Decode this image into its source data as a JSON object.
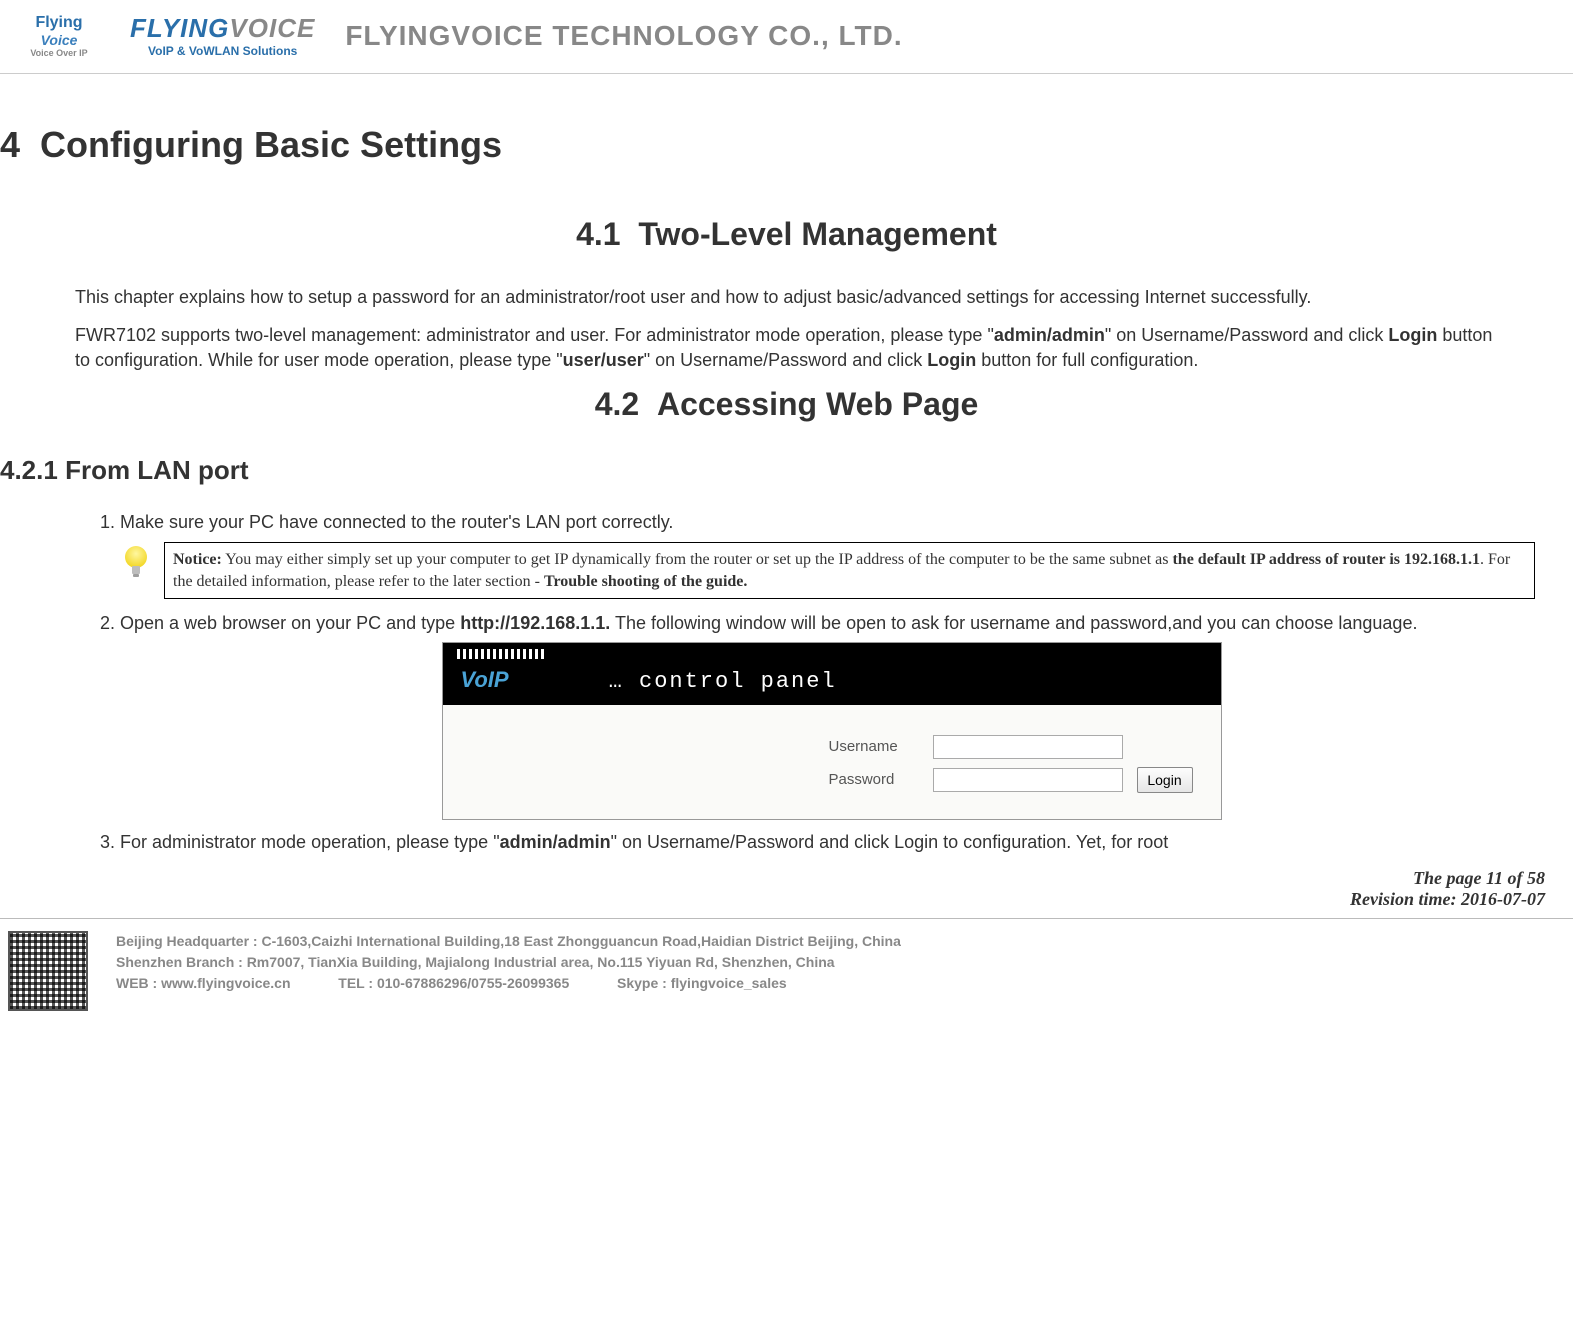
{
  "header": {
    "logo_left": {
      "line1": "Flying",
      "line2": "Voice",
      "line3": "Voice Over IP"
    },
    "logo_mid": {
      "main_a": "FLYING",
      "main_b": "VOICE",
      "sub": "VoIP & VoWLAN Solutions"
    },
    "company": "FLYINGVOICE TECHNOLOGY CO., LTD."
  },
  "chapter": {
    "num": "4",
    "title": "Configuring Basic Settings"
  },
  "s41": {
    "num": "4.1",
    "title": "Two-Level Management",
    "p1": "This chapter explains how to setup a password for an administrator/root user and how to adjust basic/advanced settings for accessing Internet successfully.",
    "p2a": "FWR7102 supports two-level management: administrator and user. For administrator mode operation, please type \"",
    "p2_admin": "admin/admin",
    "p2b": "\" on Username/Password and click ",
    "p2_login1": "Login",
    "p2c": " button to configuration. While for user mode operation, please type \"",
    "p2_user": "user/user",
    "p2d": "\" on Username/Password and click ",
    "p2_login2": "Login",
    "p2e": " button for full configuration."
  },
  "s42": {
    "num": "4.2",
    "title": "Accessing Web Page"
  },
  "s421": {
    "num": "4.2.1",
    "title": "From LAN port"
  },
  "steps": {
    "s1": "Make sure your PC have connected to the router's LAN port correctly.",
    "notice_label": "Notice:",
    "notice_a": " You may either simply set up your computer to get IP dynamically from the router or set up the IP address of the computer to be the same subnet as ",
    "notice_b": "the default IP address of router is 192.168.1.1",
    "notice_c": ". For the detailed information, please refer to the later section - ",
    "notice_d": "Trouble shooting of the guide.",
    "s2a": "Open a web browser on your PC and type ",
    "s2url": "http://192.168.1.1.",
    "s2b": " The following window will be open to ask for username and password,and you can choose language.",
    "s3a": "For administrator mode operation, please type \"",
    "s3admin": "admin/admin",
    "s3b": "\" on Username/Password and click Login to configuration. Yet, for root"
  },
  "login_panel": {
    "voip": "VoIP",
    "dots": "… control panel",
    "username_label": "Username",
    "password_label": "Password",
    "login_btn": "Login",
    "username_value": "",
    "password_value": ""
  },
  "meta": {
    "page": "The page 11 of 58",
    "rev": "Revision time: 2016-07-07"
  },
  "footer": {
    "l1a": "Beijing Headquarter ",
    "l1b": ": C-1603,Caizhi International Building,18 East Zhongguancun Road,Haidian District Beijing, China",
    "l2a": "Shenzhen Branch : ",
    "l2b": "Rm7007, TianXia Building, Majialong Industrial area, No.115 Yiyuan Rd, Shenzhen, China",
    "l3a": "WEB : ",
    "l3b": "www.flyingvoice.cn",
    "l3c": "TEL : ",
    "l3d": "010-67886296/0755-26099365",
    "l3e": "Skype : ",
    "l3f": "flyingvoice_sales"
  }
}
